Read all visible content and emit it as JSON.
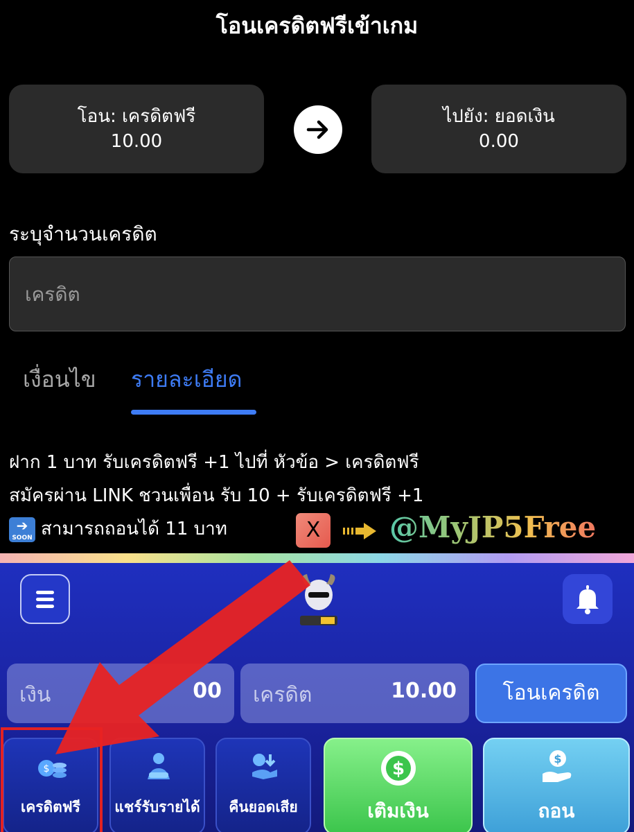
{
  "transfer": {
    "title": "โอนเครดิตฟรีเข้าเกม",
    "from_label": "โอน: เครดิตฟรี",
    "from_value": "10.00",
    "to_label": "ไปยัง: ยอดเงิน",
    "to_value": "0.00",
    "amount_label": "ระบุจำนวนเครดิต",
    "amount_placeholder": "เครดิต",
    "tabs": [
      {
        "label": "เงื่อนไข",
        "active": false
      },
      {
        "label": "รายละเอียด",
        "active": true
      }
    ],
    "details": [
      "ฝาก 1 บาท รับเครดิตฟรี +1 ไปที่ หัวข้อ > เครดิตฟรี",
      "สมัครผ่าน LINK ชวนเพื่อน รับ 10 + รับเครดิตฟรี +1",
      "สามารถถอนได้ 11 บาท"
    ],
    "soon_badge": "SOON"
  },
  "promo": {
    "x_label": "X",
    "handle": "@MyJP5Free"
  },
  "app": {
    "logo_icon": "goat-mascot-logo",
    "money_label": "เงิน",
    "money_value": "00",
    "credit_label": "เครดิต",
    "credit_value": "10.00",
    "transfer_button": "โอนเครดิต",
    "actions": [
      {
        "label": "เครดิตฟรี",
        "icon": "coins-icon"
      },
      {
        "label": "แชร์รับรายได้",
        "icon": "share-income-icon"
      },
      {
        "label": "คืนยอดเสีย",
        "icon": "cashback-icon"
      }
    ],
    "deposit_label": "เติมเงิน",
    "withdraw_label": "ถอน"
  },
  "colors": {
    "accent_blue": "#3e7cf5",
    "annotation_red": "#e32222",
    "app_blue": "#1f2fbf",
    "deposit_green": "#3cc54c",
    "withdraw_blue": "#3ea0d8"
  }
}
